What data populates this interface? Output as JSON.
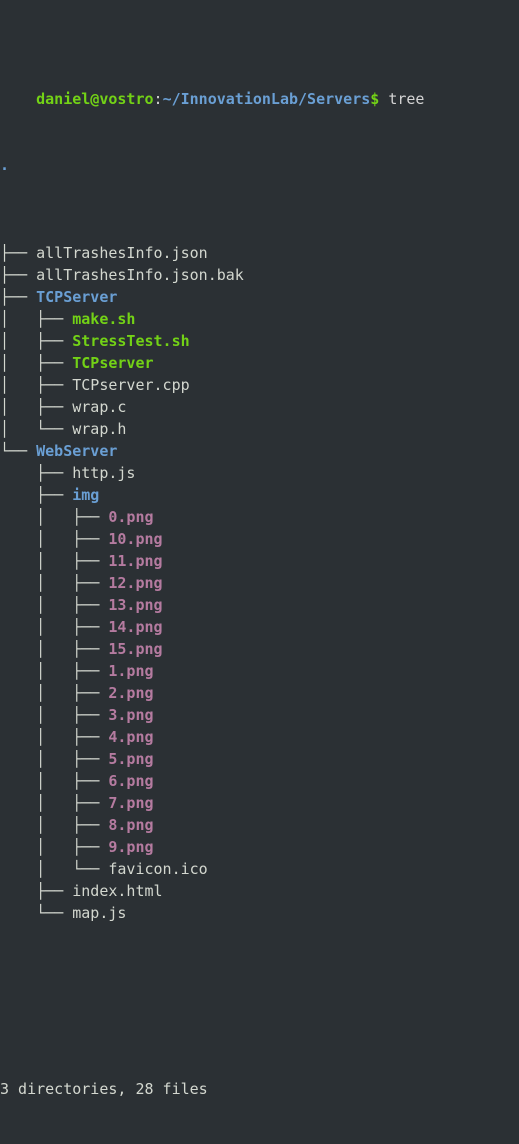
{
  "terminal": {
    "background_color": "#2b3034",
    "foreground_color": "#d4d4d4",
    "prompt": {
      "user_host": "daniel@vostro",
      "separator": ":",
      "path": "~/InnovationLab/Servers",
      "symbol": "$",
      "command": "tree",
      "user_host_color": "#73d216",
      "path_color": "#6a9fd4"
    },
    "root": ".",
    "lines": [
      {
        "branch": "├── ",
        "name": "allTrashesInfo.json",
        "kind": "file"
      },
      {
        "branch": "├── ",
        "name": "allTrashesInfo.json.bak",
        "kind": "file"
      },
      {
        "branch": "├── ",
        "name": "TCPServer",
        "kind": "dir"
      },
      {
        "branch": "│   ├── ",
        "name": "make.sh",
        "kind": "exec"
      },
      {
        "branch": "│   ├── ",
        "name": "StressTest.sh",
        "kind": "exec"
      },
      {
        "branch": "│   ├── ",
        "name": "TCPserver",
        "kind": "exec"
      },
      {
        "branch": "│   ├── ",
        "name": "TCPserver.cpp",
        "kind": "file"
      },
      {
        "branch": "│   ├── ",
        "name": "wrap.c",
        "kind": "file"
      },
      {
        "branch": "│   └── ",
        "name": "wrap.h",
        "kind": "file"
      },
      {
        "branch": "└── ",
        "name": "WebServer",
        "kind": "dir"
      },
      {
        "branch": "    ├── ",
        "name": "http.js",
        "kind": "file"
      },
      {
        "branch": "    ├── ",
        "name": "img",
        "kind": "dir"
      },
      {
        "branch": "    │   ├── ",
        "name": "0.png",
        "kind": "img"
      },
      {
        "branch": "    │   ├── ",
        "name": "10.png",
        "kind": "img"
      },
      {
        "branch": "    │   ├── ",
        "name": "11.png",
        "kind": "img"
      },
      {
        "branch": "    │   ├── ",
        "name": "12.png",
        "kind": "img"
      },
      {
        "branch": "    │   ├── ",
        "name": "13.png",
        "kind": "img"
      },
      {
        "branch": "    │   ├── ",
        "name": "14.png",
        "kind": "img"
      },
      {
        "branch": "    │   ├── ",
        "name": "15.png",
        "kind": "img"
      },
      {
        "branch": "    │   ├── ",
        "name": "1.png",
        "kind": "img"
      },
      {
        "branch": "    │   ├── ",
        "name": "2.png",
        "kind": "img"
      },
      {
        "branch": "    │   ├── ",
        "name": "3.png",
        "kind": "img"
      },
      {
        "branch": "    │   ├── ",
        "name": "4.png",
        "kind": "img"
      },
      {
        "branch": "    │   ├── ",
        "name": "5.png",
        "kind": "img"
      },
      {
        "branch": "    │   ├── ",
        "name": "6.png",
        "kind": "img"
      },
      {
        "branch": "    │   ├── ",
        "name": "7.png",
        "kind": "img"
      },
      {
        "branch": "    │   ├── ",
        "name": "8.png",
        "kind": "img"
      },
      {
        "branch": "    │   ├── ",
        "name": "9.png",
        "kind": "img"
      },
      {
        "branch": "    │   └── ",
        "name": "favicon.ico",
        "kind": "file"
      },
      {
        "branch": "    ├── ",
        "name": "index.html",
        "kind": "file"
      },
      {
        "branch": "    └── ",
        "name": "map.js",
        "kind": "file"
      }
    ],
    "summary": "3 directories, 28 files"
  }
}
